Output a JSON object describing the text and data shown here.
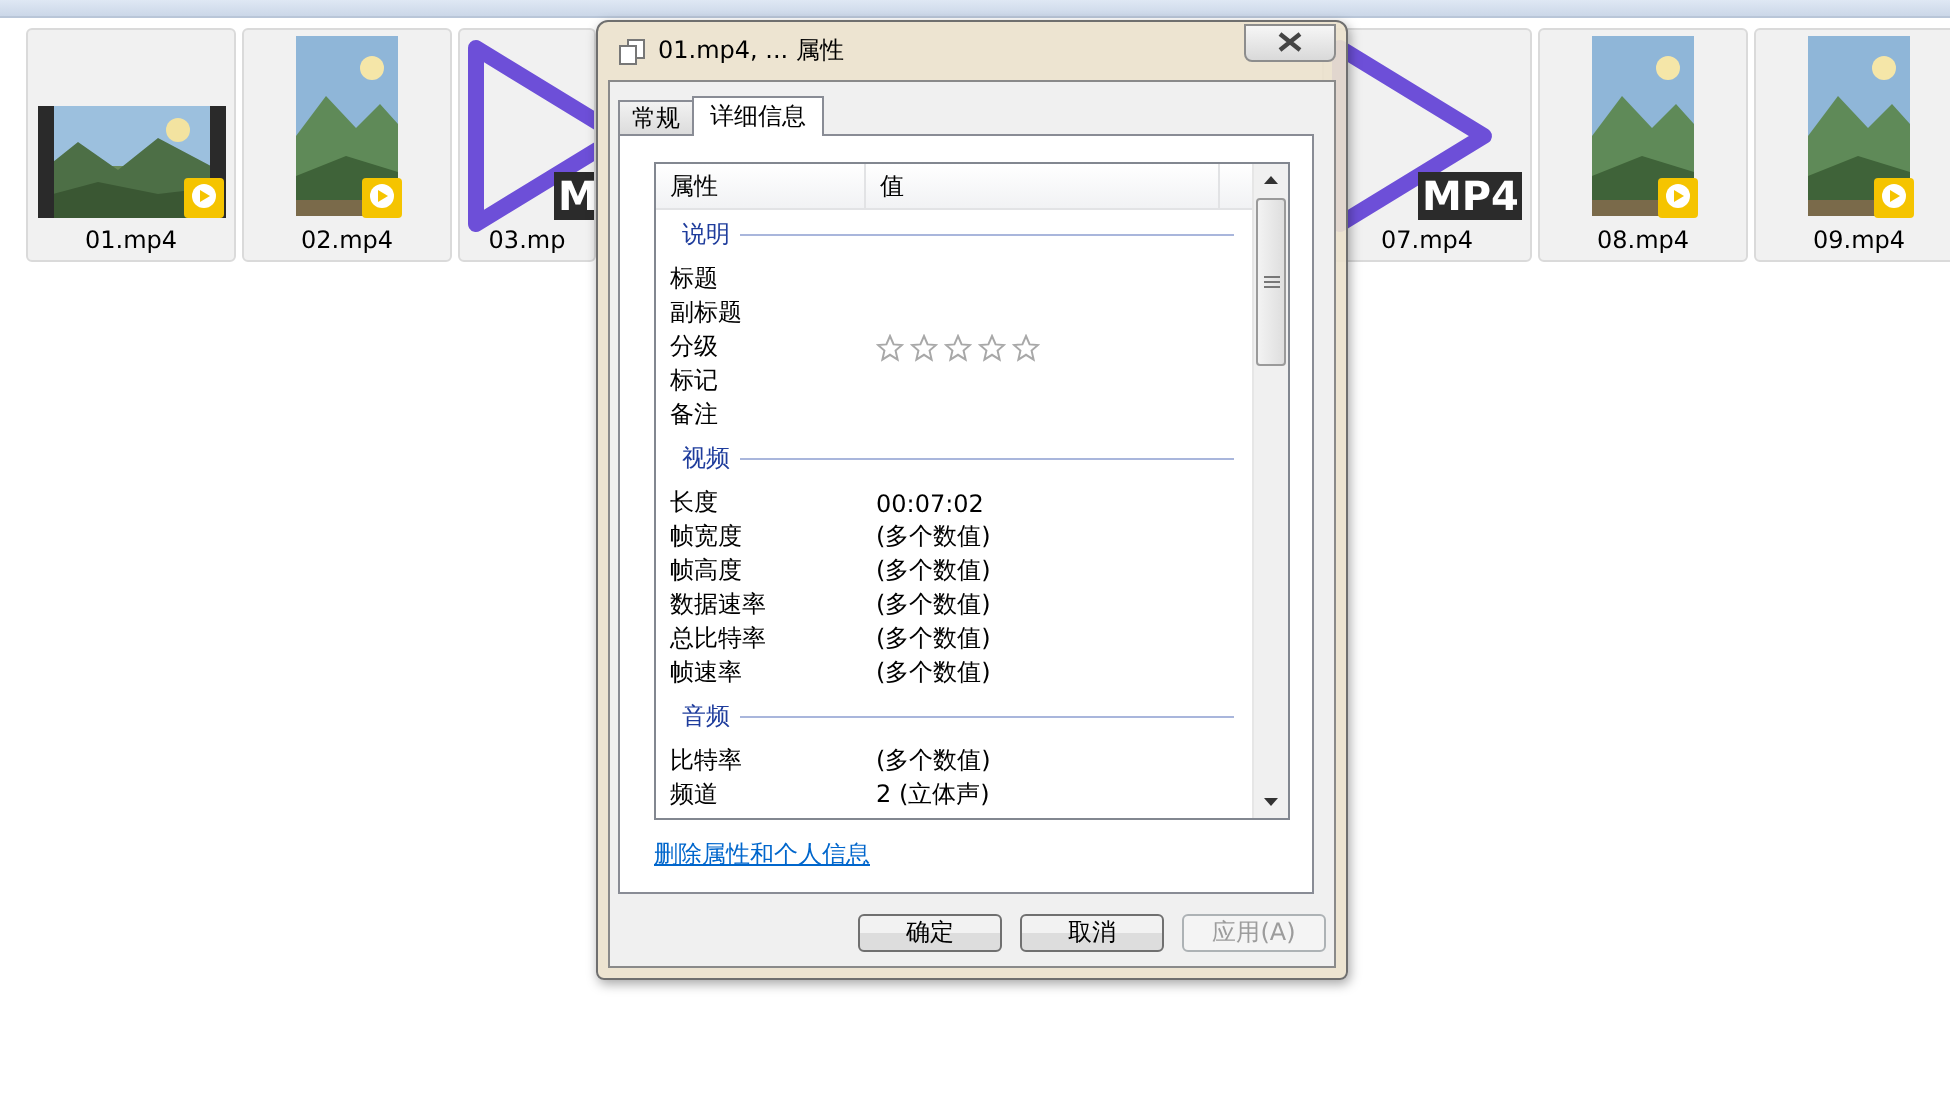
{
  "file_tiles": [
    {
      "label": "01.mp4",
      "kind": "landscape_video"
    },
    {
      "label": "02.mp4",
      "kind": "portrait_video"
    },
    {
      "label": "03.mp",
      "kind": "mp4_icon",
      "badge": "M"
    },
    {
      "label": "07.mp4",
      "kind": "mp4_icon",
      "badge": "MP4"
    },
    {
      "label": "08.mp4",
      "kind": "portrait_video"
    },
    {
      "label": "09.mp4",
      "kind": "portrait_video"
    }
  ],
  "dialog": {
    "title": "01.mp4, ... 属性",
    "tabs": [
      {
        "label": "常规",
        "selected": false
      },
      {
        "label": "详细信息",
        "selected": true
      }
    ],
    "columns": [
      "属性",
      "值"
    ],
    "groups": [
      {
        "heading": "说明",
        "rows": [
          {
            "kind": "text",
            "name": "标题"
          },
          {
            "kind": "text",
            "name": "副标题"
          },
          {
            "kind": "stars",
            "name": "分级",
            "stars": 0
          },
          {
            "kind": "text",
            "name": "标记"
          },
          {
            "kind": "text",
            "name": "备注"
          }
        ]
      },
      {
        "heading": "视频",
        "rows": [
          {
            "kind": "text",
            "name": "长度",
            "value": "00:07:02"
          },
          {
            "kind": "text",
            "name": "帧宽度",
            "value": "(多个数值)"
          },
          {
            "kind": "text",
            "name": "帧高度",
            "value": "(多个数值)"
          },
          {
            "kind": "text",
            "name": "数据速率",
            "value": "(多个数值)"
          },
          {
            "kind": "text",
            "name": "总比特率",
            "value": "(多个数值)"
          },
          {
            "kind": "text",
            "name": "帧速率",
            "value": "(多个数值)"
          }
        ]
      },
      {
        "heading": "音频",
        "rows": [
          {
            "kind": "text",
            "name": "比特率",
            "value": "(多个数值)"
          },
          {
            "kind": "text",
            "name": "频道",
            "value": "2 (立体声)"
          }
        ]
      }
    ],
    "link": "删除属性和个人信息",
    "buttons": [
      {
        "label": "确定",
        "disabled": false
      },
      {
        "label": "取消",
        "disabled": false
      },
      {
        "label": "应用(A)",
        "disabled": true
      }
    ]
  }
}
